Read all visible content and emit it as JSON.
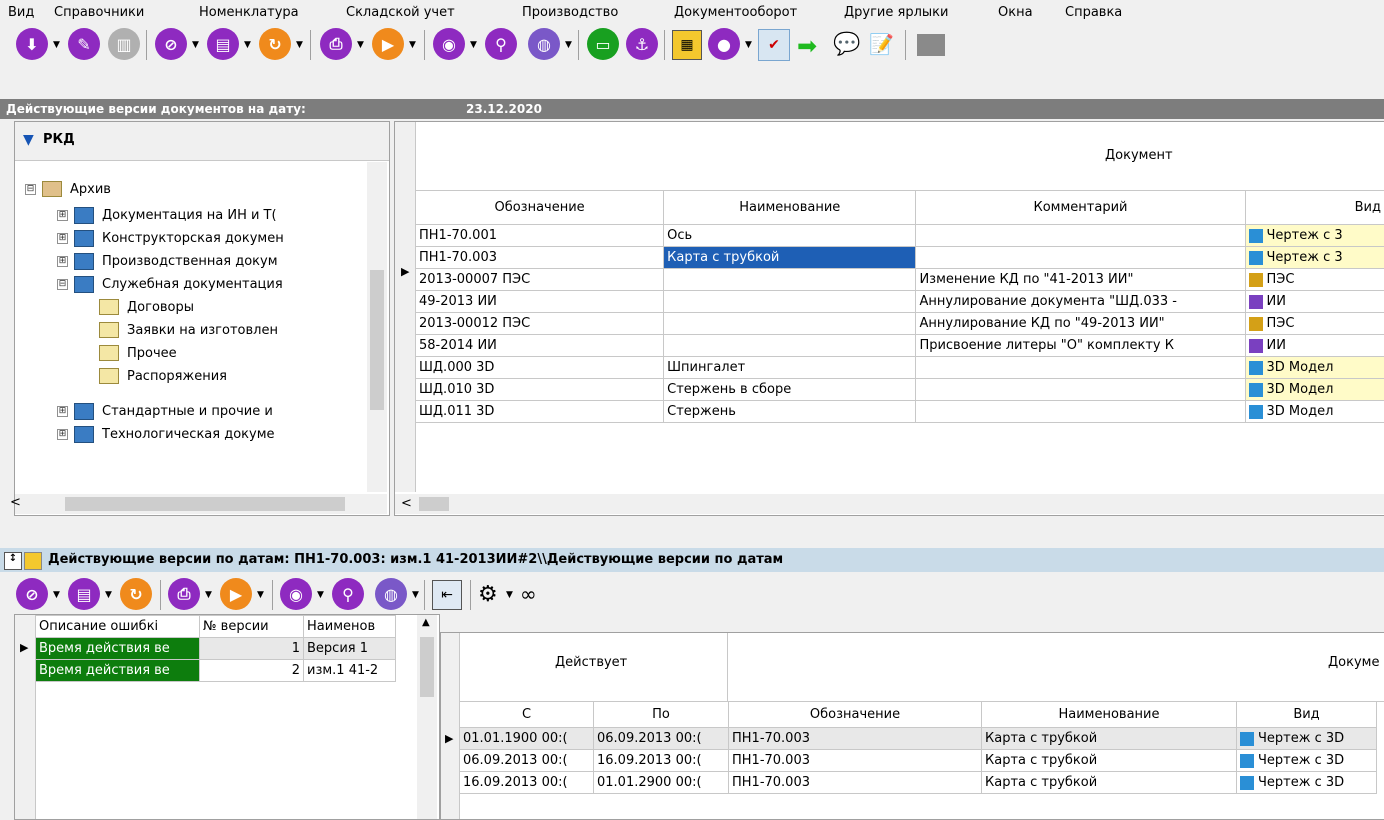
{
  "menu": [
    "Вид",
    "Справочники",
    "Номенклатура",
    "Складской учет",
    "Производство",
    "Документооборот",
    "Другие ярлыки",
    "Окна",
    "Справка"
  ],
  "date_strip": {
    "label": "Действующие версии документов на дату:",
    "date": "23.12.2020"
  },
  "tree": {
    "title": "РКД",
    "items": [
      {
        "label": "Архив",
        "expander": "⊟"
      },
      {
        "label": "Документация на ИН и Т(",
        "expander": "⊞"
      },
      {
        "label": "Конструкторская докумен",
        "expander": "⊞"
      },
      {
        "label": "Производственная докум",
        "expander": "⊞"
      },
      {
        "label": "Служебная документация",
        "expander": "⊟"
      },
      {
        "label": "Договоры"
      },
      {
        "label": "Заявки на изготовлен"
      },
      {
        "label": "Прочее"
      },
      {
        "label": "Распоряжения"
      },
      {
        "label": "Стандартные и прочие и",
        "expander": "⊞"
      },
      {
        "label": "Технологическая докуме",
        "expander": "⊞"
      }
    ]
  },
  "main_grid": {
    "group": "Документ",
    "columns": [
      "Обозначение",
      "Наименование",
      "Комментарий",
      "Вид"
    ],
    "rows": [
      [
        "ПН1-70.001",
        "Ось",
        "",
        "Чертеж с 3"
      ],
      [
        "ПН1-70.003",
        "Карта с трубкой",
        "",
        "Чертеж с 3"
      ],
      [
        "2013-00007 ПЭС",
        "",
        "Изменение КД по \"41-2013 ИИ\"",
        "ПЭС"
      ],
      [
        "49-2013 ИИ",
        "",
        "Аннулирование документа \"ШД.033 -",
        "ИИ"
      ],
      [
        "2013-00012 ПЭС",
        "",
        "Аннулирование КД по \"49-2013 ИИ\"",
        "ПЭС"
      ],
      [
        "58-2014 ИИ",
        "",
        "Присвоение литеры \"О\" комплекту К",
        "ИИ"
      ],
      [
        "ШД.000 3D",
        "Шпингалет",
        "",
        "3D Модел"
      ],
      [
        "ШД.010 3D",
        "Стержень в сборе",
        "",
        "3D Модел"
      ],
      [
        "ШД.011 3D",
        "Стержень",
        "",
        "3D Модел"
      ]
    ]
  },
  "sub_title": "Действующие версии по датам: ПН1-70.003: изм.1 41-2013ИИ#2\\\\Действующие версии по датам",
  "versions_grid": {
    "columns": [
      "Описание ошибкі",
      "№ версии",
      "Наименов"
    ],
    "rows": [
      [
        "Время действия ве",
        "1",
        "Версия 1"
      ],
      [
        "Время действия ве",
        "2",
        "изм.1 41-2"
      ]
    ]
  },
  "dates_grid": {
    "group1": "Действует",
    "group2": "Докуме",
    "columns": [
      "С",
      "По",
      "Обозначение",
      "Наименование",
      "Вид"
    ],
    "rows": [
      [
        "01.01.1900 00:(",
        "06.09.2013 00:(",
        "ПН1-70.003",
        "Карта с трубкой",
        "Чертеж с 3D"
      ],
      [
        "06.09.2013 00:(",
        "16.09.2013 00:(",
        "ПН1-70.003",
        "Карта с трубкой",
        "Чертеж с 3D"
      ],
      [
        "16.09.2013 00:(",
        "01.01.2900 00:(",
        "ПН1-70.003",
        "Карта с трубкой",
        "Чертеж с 3D"
      ]
    ]
  }
}
